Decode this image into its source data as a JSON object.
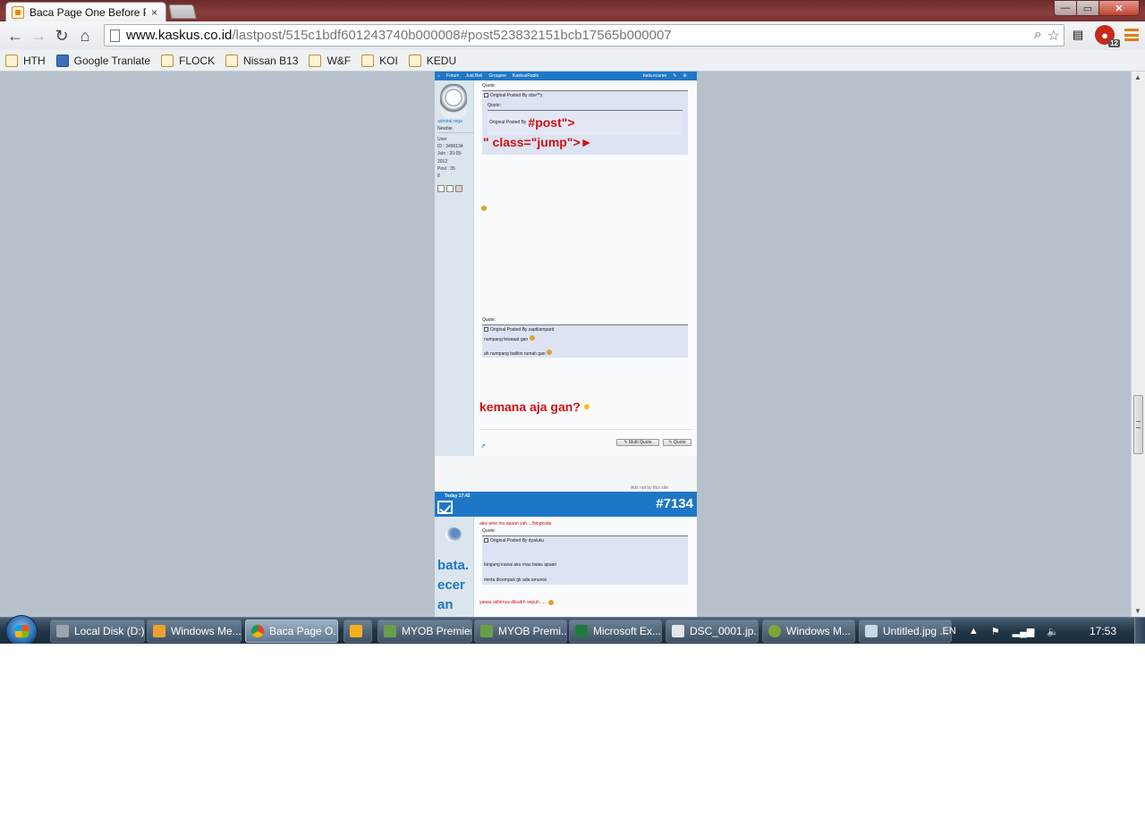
{
  "browser": {
    "tab_title": "Baca Page One Before Post",
    "tab_close": "×",
    "url_host": "www.kaskus.co.id",
    "url_path": "/lastpost/515c1bdf601243740b000008#post523832151bcb17565b000007",
    "ext_badge": "12",
    "window_controls": {
      "minimize": "—",
      "maximize": "▭",
      "close": "✕"
    }
  },
  "bookmarks": [
    "HTH",
    "Google Tranlate",
    "FLOCK",
    "Nissan B13",
    "W&F",
    "KOI",
    "KEDU"
  ],
  "page": {
    "topnav": {
      "items": [
        "⌂",
        "Forum",
        "Jual Beli",
        "Groupee",
        "KaskusRadio"
      ],
      "user": "bata.ecaran"
    },
    "post1": {
      "username": "admiral.rega",
      "rank": "Newbie",
      "meta": [
        "User",
        "ID : 3490134",
        "Join : 20-05-2012",
        "Post : 35",
        "8"
      ],
      "quote_label": "Quote:",
      "quote1_by": "Original Posted By cibe**y",
      "inner_quote_label": "Quote:",
      "inner_quote_by": "Original Posted By",
      "broken_link_1": "#post\">",
      "broken_link_2": "\" class=\"jump\">►",
      "quote2_label": "Quote:",
      "quote2_by": "Original Posted By saptilampard",
      "quote2_line1": "numpang lewaaat gan",
      "quote2_line2": "ah numpang balikin rumah gan",
      "reply": "kemana aja gan?",
      "multi_quote": "✎ Multi Quote",
      "quote_btn": "✎ Quote"
    },
    "ad_note": "Ads not by this site",
    "post2": {
      "date": "Today 17:42",
      "number": "#7134",
      "username": "bata.\necer\nan",
      "reply_top": "akw ame mu apaan yah....!bingkuda",
      "quote_label": "Quote:",
      "quote_by": "Original Posted By dyaluku",
      "quote_line1": "bingung kuwai aku mau balas apaan",
      "quote_line2": "minta dicempuk gk ada amunisi",
      "reply_bottom": "yaaaa akhirnya dikudrh sepuh......"
    }
  },
  "taskbar": {
    "tasks": [
      "Local Disk (D:)",
      "Windows Me...",
      "Baca Page O...",
      "",
      "MYOB Premier",
      "MYOB Premi...",
      "Microsoft Ex...",
      "DSC_0001.jp...",
      "Windows M...",
      "Untitled.jpg ..."
    ],
    "lang": "EN",
    "clock": "17:53"
  },
  "colors": {
    "kaskus_blue": "#1e77c6",
    "red_text": "#d01010",
    "page_bg": "#b6c1cb"
  }
}
